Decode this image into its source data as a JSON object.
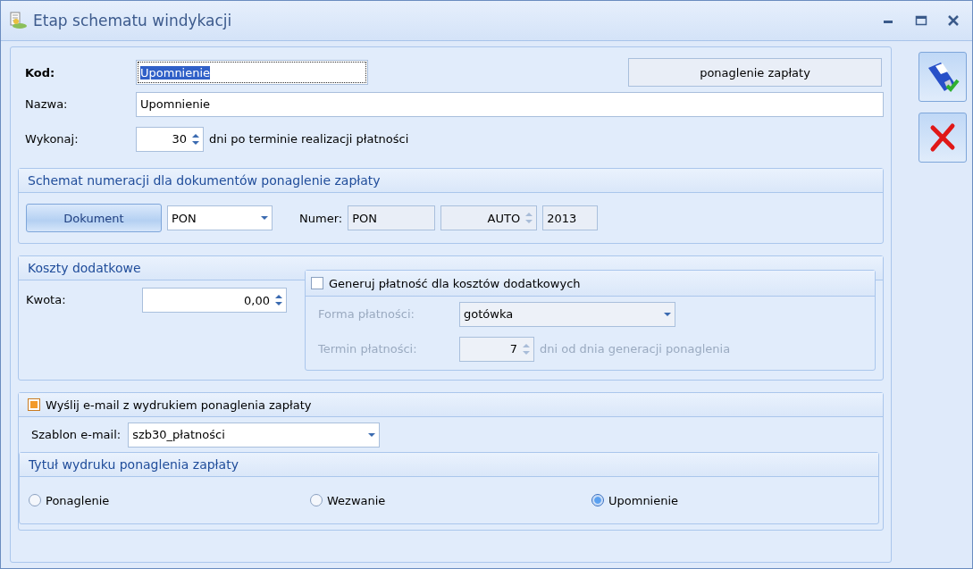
{
  "window": {
    "title": "Etap schematu windykacji"
  },
  "kod": {
    "label": "Kod:",
    "value": "Upomnienie",
    "focused": true
  },
  "type_label": "ponaglenie zapłaty",
  "nazwa": {
    "label": "Nazwa:",
    "value": "Upomnienie"
  },
  "wykonaj": {
    "label": "Wykonaj:",
    "value": "30",
    "suffix": "dni po terminie realizacji płatności"
  },
  "numbering": {
    "title": "Schemat numeracji dla dokumentów ponaglenie zapłaty",
    "button": "Dokument",
    "combo": "PON",
    "numer_label": "Numer:",
    "prefix": "PON",
    "mode": "AUTO",
    "year": "2013"
  },
  "costs": {
    "title": "Koszty dodatkowe",
    "kwota_label": "Kwota:",
    "kwota": "0,00",
    "payment": {
      "checked": false,
      "label": "Generuj płatność dla kosztów dodatkowych",
      "forma_label": "Forma płatności:",
      "forma": "gotówka",
      "termin_label": "Termin płatności:",
      "termin": "7",
      "termin_suffix": "dni od dnia generacji ponaglenia"
    }
  },
  "email": {
    "checked": true,
    "label": "Wyślij e-mail z wydrukiem ponaglenia zapłaty",
    "szablon_label": "Szablon e-mail:",
    "szablon": "szb30_płatności"
  },
  "print_title": {
    "title": "Tytuł wydruku ponaglenia zapłaty",
    "options": [
      {
        "label": "Ponaglenie",
        "selected": false
      },
      {
        "label": "Wezwanie",
        "selected": false
      },
      {
        "label": "Upomnienie",
        "selected": true
      }
    ]
  }
}
